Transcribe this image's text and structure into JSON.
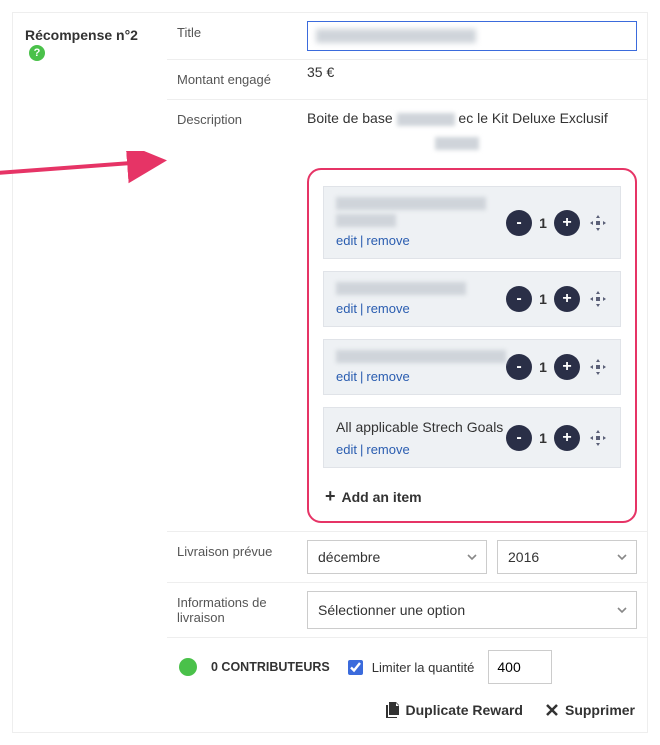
{
  "side": {
    "label": "Récompense n°2"
  },
  "fields": {
    "title_label": "Title",
    "amount_label": "Montant engagé",
    "amount_value": "35 €",
    "description_label": "Description",
    "description_prefix": "Boite de base",
    "description_suffix": "ec le Kit Deluxe Exclusif",
    "delivery_label": "Livraison prévue",
    "delivery_month": "décembre",
    "delivery_year": "2016",
    "shipinfo_label": "Informations de livraison",
    "shipinfo_value": "Sélectionner une option"
  },
  "items": {
    "edit": "edit",
    "remove": "remove",
    "qty1": "1",
    "qty2": "1",
    "qty3": "1",
    "qty4": "1",
    "item4_title": "All applicable Strech Goals",
    "add_label": "Add an item"
  },
  "footer": {
    "contrib": "0 CONTRIBUTEURS",
    "limit_label": "Limiter la quantité",
    "limit_value": "400"
  },
  "actions": {
    "duplicate": "Duplicate Reward",
    "delete": "Supprimer"
  }
}
